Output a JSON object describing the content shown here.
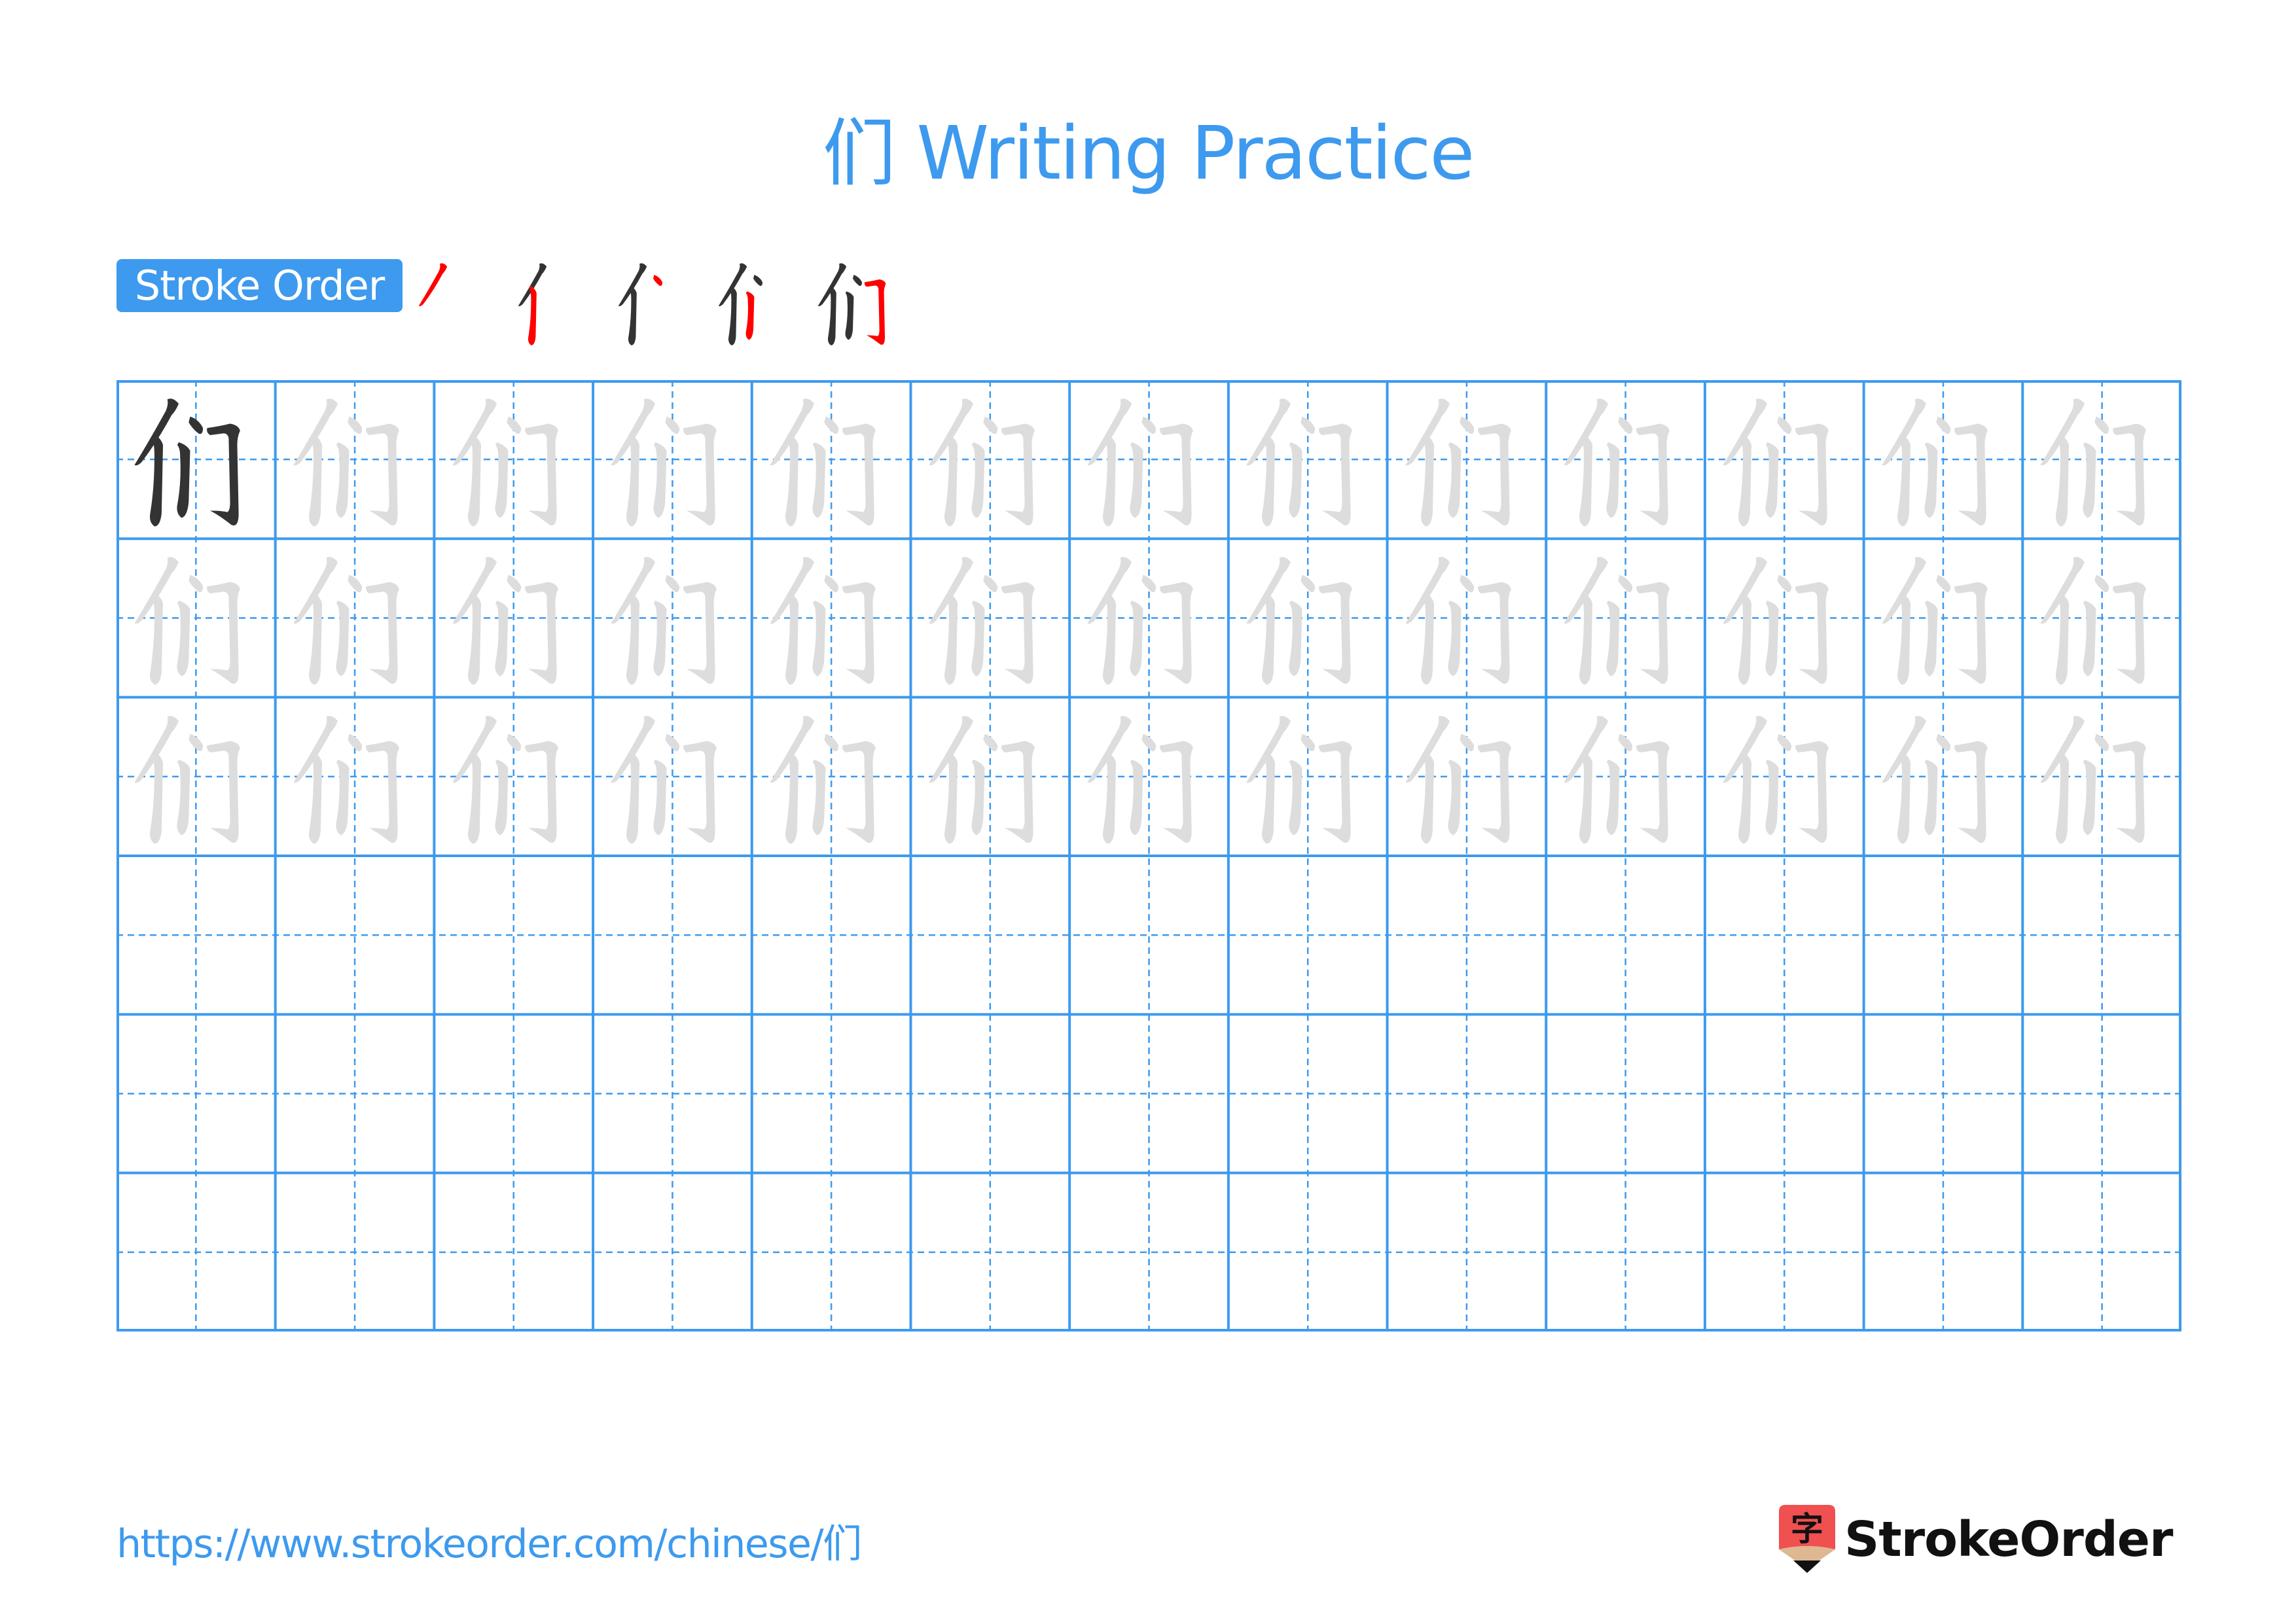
{
  "document": {
    "title": "们 Writing Practice",
    "character": "们",
    "stroke_order_label": "Stroke Order",
    "stroke_count": 5,
    "grid": {
      "rows": 6,
      "columns": 13,
      "solid_rows": 1,
      "trace_rows": 2,
      "blank_rows": 3
    },
    "footer_url": "https://www.strokeorder.com/chinese/们",
    "brand": {
      "name": "StrokeOrder",
      "icon_char": "字"
    }
  },
  "colors": {
    "accent": "#3d9aee",
    "grid_line": "#3d9aee",
    "character_solid": "#333333",
    "character_trace": "#dddddd",
    "stroke_highlight": "#ff0000",
    "logo_red": "#f05050",
    "logo_tan": "#ddb893"
  }
}
